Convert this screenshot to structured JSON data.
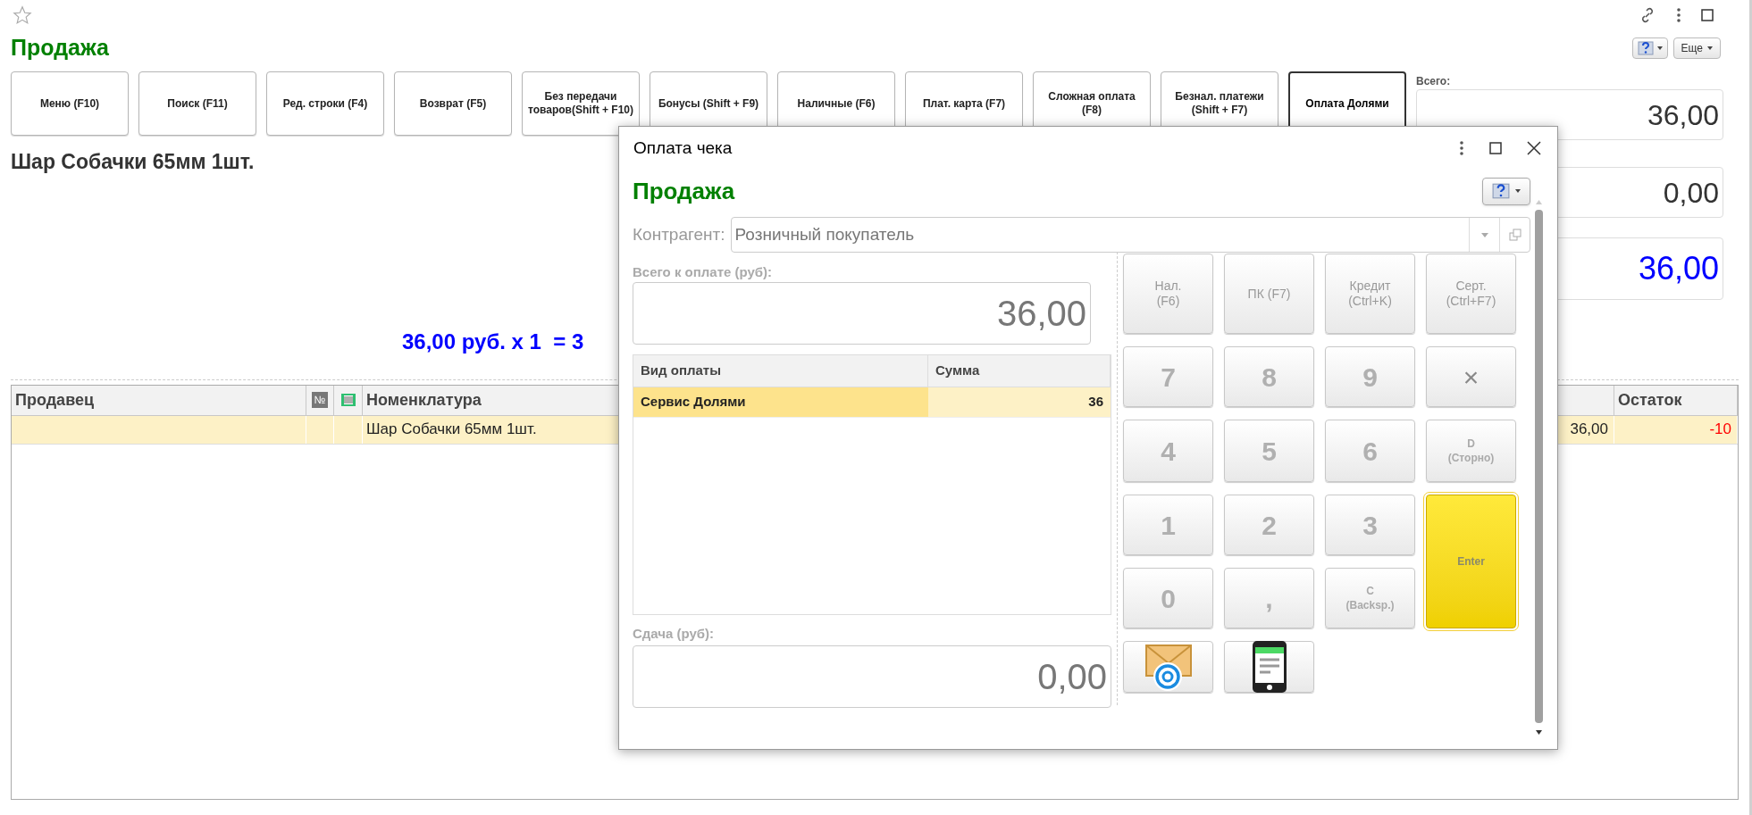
{
  "page": {
    "title": "Продажа",
    "more_button": "Еще"
  },
  "toolbar": [
    {
      "label": "Меню (F10)",
      "selected": false
    },
    {
      "label": "Поиск (F11)",
      "selected": false
    },
    {
      "label": "Ред. строки (F4)",
      "selected": false
    },
    {
      "label": "Возврат (F5)",
      "selected": false
    },
    {
      "label": "Без передачи товаров(Shift + F10)",
      "selected": false
    },
    {
      "label": "Бонусы (Shift + F9)",
      "selected": false
    },
    {
      "label": "Наличные (F6)",
      "selected": false
    },
    {
      "label": "Плат. карта (F7)",
      "selected": false
    },
    {
      "label": "Сложная оплата (F8)",
      "selected": false
    },
    {
      "label": "Безнал. платежи (Shift + F7)",
      "selected": false
    },
    {
      "label": "Оплата Долями",
      "selected": true
    }
  ],
  "product_name": "Шар Собачки 65мм 1шт.",
  "price_line": "36,00 руб. x 1  = 3",
  "totals": [
    {
      "label": "Всего:",
      "value": "36,00",
      "kind": "normal"
    },
    {
      "value": "0,00",
      "kind": "normal"
    },
    {
      "value": "36,00",
      "kind": "highlight"
    }
  ],
  "table": {
    "columns": [
      {
        "kind": "text",
        "label": "Продавец"
      },
      {
        "kind": "badge",
        "label": "№"
      },
      {
        "kind": "barcode"
      },
      {
        "kind": "text",
        "label": "Номенклатура"
      },
      {
        "kind": "hidden"
      },
      {
        "kind": "text",
        "label": "Остаток"
      }
    ],
    "rows": [
      {
        "selected": true,
        "item": "Шар Собачки 65мм 1шт.",
        "column_5": "36,00",
        "balance": "-10",
        "negative": true
      }
    ]
  },
  "dialog": {
    "title": "Оплата чека",
    "heading": "Продажа",
    "counterparty": {
      "label": "Контрагент:",
      "value": "Розничный покупатель"
    },
    "total": {
      "label": "Всего к оплате (руб):",
      "value": "36,00"
    },
    "payments": {
      "columns": [
        "Вид оплаты",
        "Сумма"
      ],
      "rows": [
        {
          "type": "Сервис Долями",
          "amount": "36",
          "selected": true
        }
      ]
    },
    "change": {
      "label": "Сдача (руб):",
      "value": "0,00"
    },
    "keypad": [
      {
        "kind": "function",
        "label": "Нал.\n(F6)"
      },
      {
        "kind": "function",
        "label": "ПК (F7)"
      },
      {
        "kind": "function",
        "label": "Кредит\n(Ctrl+K)"
      },
      {
        "kind": "function",
        "label": "Серт.\n(Ctrl+F7)"
      },
      {
        "kind": "digit",
        "label": "7"
      },
      {
        "kind": "digit",
        "label": "8"
      },
      {
        "kind": "digit",
        "label": "9"
      },
      {
        "kind": "symbol",
        "label": "×"
      },
      {
        "kind": "digit",
        "label": "4"
      },
      {
        "kind": "digit",
        "label": "5"
      },
      {
        "kind": "digit",
        "label": "6"
      },
      {
        "kind": "small",
        "label": "D\n(Сторно)"
      },
      {
        "kind": "digit",
        "label": "1"
      },
      {
        "kind": "digit",
        "label": "2"
      },
      {
        "kind": "digit",
        "label": "3"
      },
      {
        "kind": "enter",
        "label": "Enter"
      },
      {
        "kind": "digit",
        "label": "0"
      },
      {
        "kind": "digit",
        "label": ","
      },
      {
        "kind": "small",
        "label": "C\n(Backsp.)"
      },
      {
        "kind": "email"
      },
      {
        "kind": "phone"
      }
    ]
  }
}
